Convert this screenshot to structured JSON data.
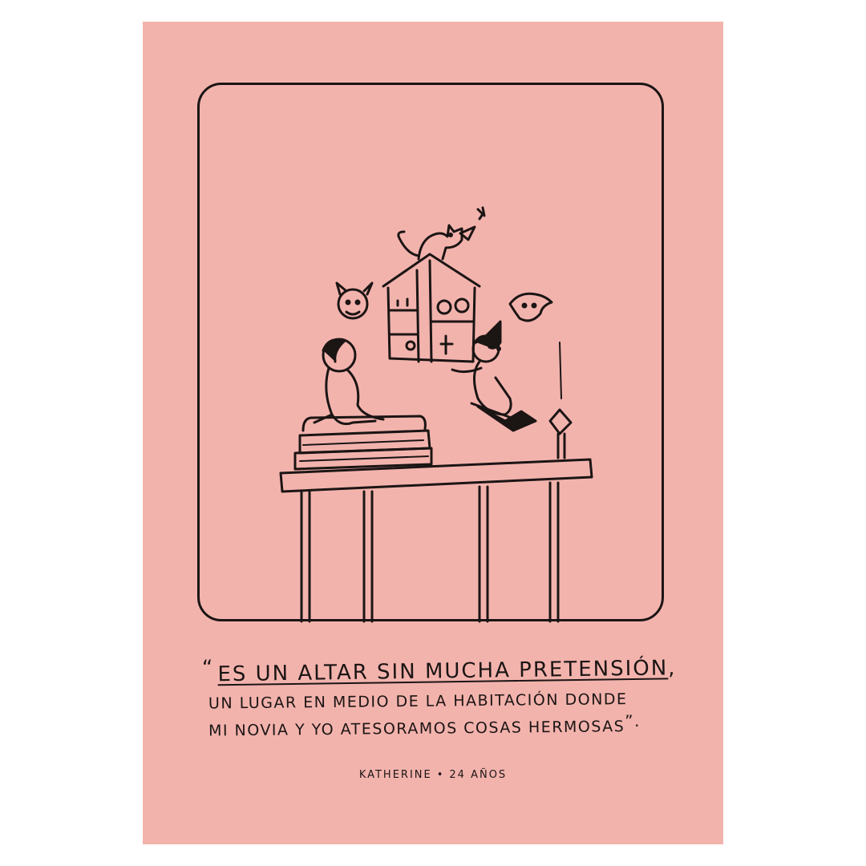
{
  "poster": {
    "background_color": "#f3b3ad",
    "ink_color": "#1b1514"
  },
  "quote": {
    "open_mark": "“",
    "line1_a": "es un altar sin mucha ",
    "line1_b": "pretensión",
    "line1_c": ",",
    "line2": "un lugar en medio de la habitación donde",
    "line3": "mi novia y yo atesoramos cosas hermosas",
    "close_mark": "”."
  },
  "credit": {
    "name": "Katherine",
    "separator": "•",
    "age": "24 años"
  }
}
